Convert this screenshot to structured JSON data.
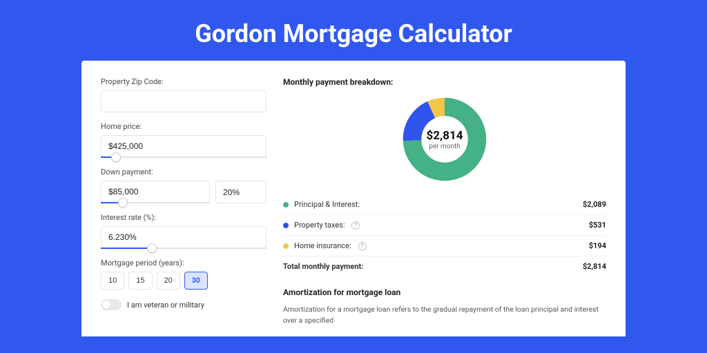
{
  "page": {
    "title": "Gordon Mortgage Calculator"
  },
  "form": {
    "zip_label": "Property Zip Code:",
    "zip_value": "",
    "home_price_label": "Home price:",
    "home_price_value": "$425,000",
    "home_price_slider_pct": 9,
    "down_payment_label": "Down payment:",
    "down_payment_value": "$85,000",
    "down_payment_pct_value": "20%",
    "down_payment_slider_pct": 20,
    "interest_label": "Interest rate (%):",
    "interest_value": "6.230%",
    "interest_slider_pct": 31,
    "period_label": "Mortgage period (years):",
    "period_options": [
      "10",
      "15",
      "20",
      "30"
    ],
    "period_selected": "30",
    "military_label": "I am veteran or military",
    "military_on": false
  },
  "chart_data": {
    "type": "pie",
    "title": "Monthly payment breakdown:",
    "center_value": "$2,814",
    "center_sub": "per month",
    "series": [
      {
        "name": "Principal & Interest:",
        "value": 2089,
        "display": "$2,089",
        "color": "#44b186"
      },
      {
        "name": "Property taxes:",
        "value": 531,
        "display": "$531",
        "color": "#2f54eb",
        "help": true
      },
      {
        "name": "Home insurance:",
        "value": 194,
        "display": "$194",
        "color": "#f3c749",
        "help": true
      }
    ],
    "total_label": "Total monthly payment:",
    "total_display": "$2,814"
  },
  "amortization": {
    "heading": "Amortization for mortgage loan",
    "body": "Amortization for a mortgage loan refers to the gradual repayment of the loan principal and interest over a specified"
  }
}
